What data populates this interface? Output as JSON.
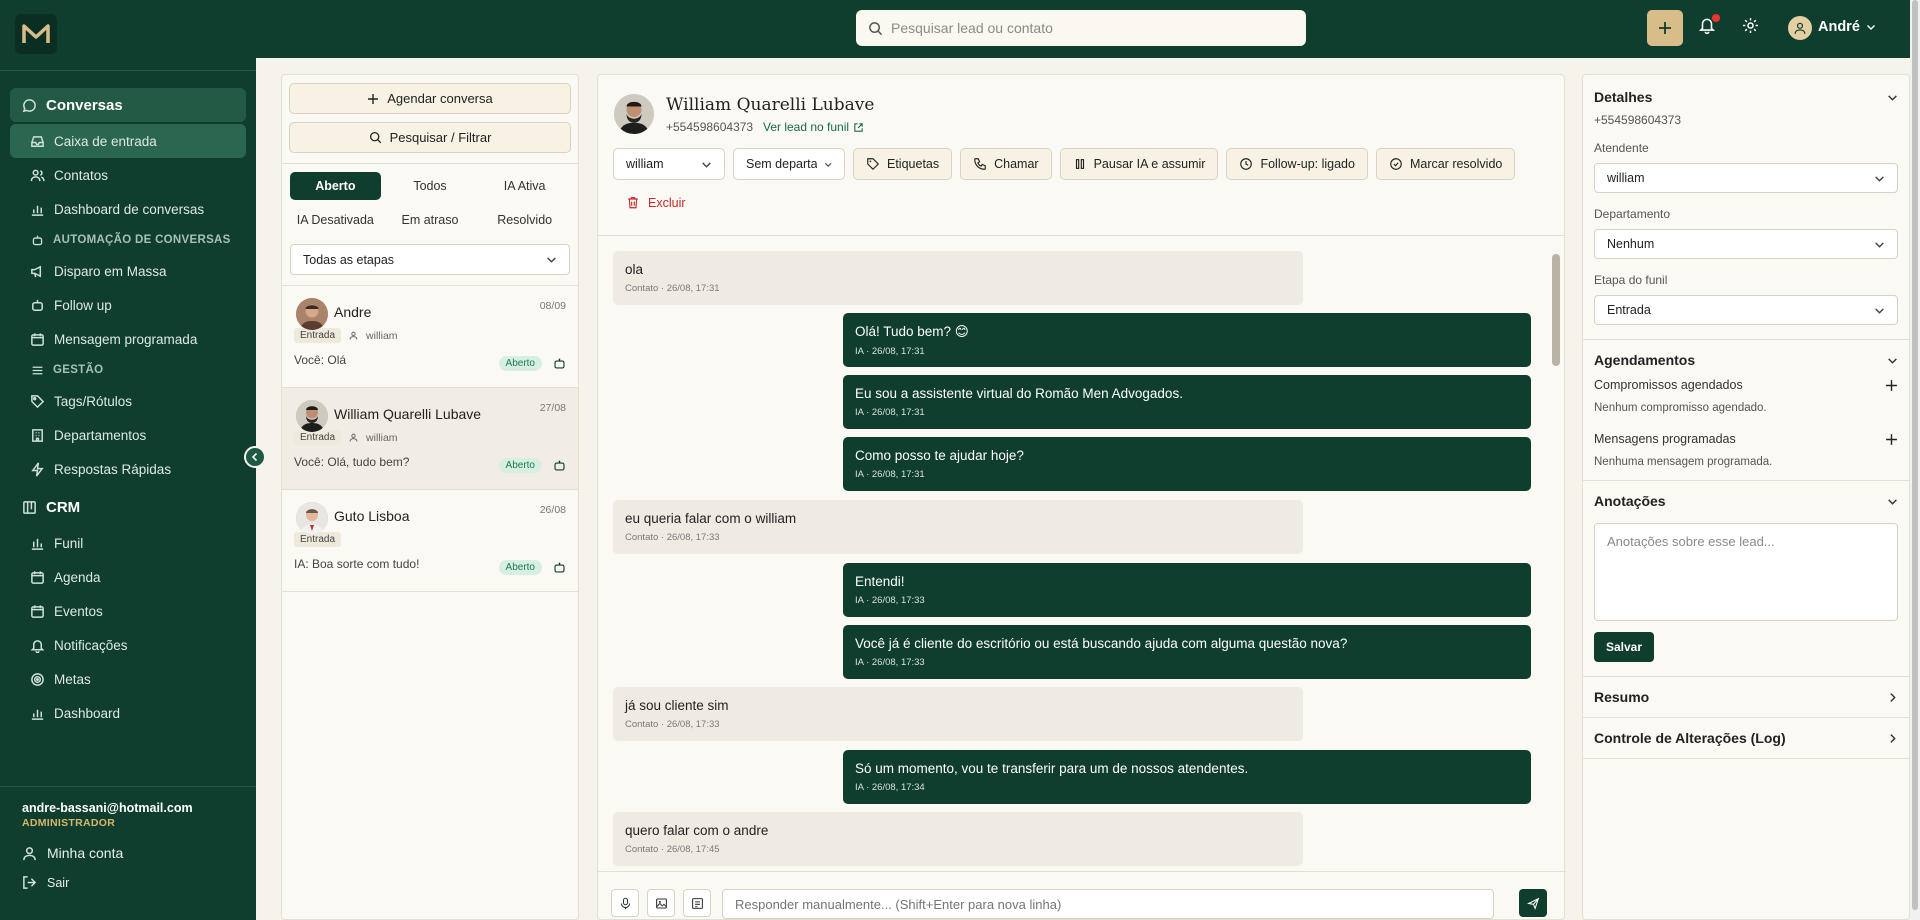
{
  "app": {
    "logo_letter": "M"
  },
  "topbar": {
    "search_placeholder": "Pesquisar lead ou contato",
    "user_name": "André"
  },
  "sidebar": {
    "items": [
      {
        "label": "Conversas"
      },
      {
        "label": "Caixa de entrada"
      },
      {
        "label": "Contatos"
      },
      {
        "label": "Dashboard de conversas"
      },
      {
        "label": "AUTOMAÇÃO DE CONVERSAS"
      },
      {
        "label": "Disparo em Massa"
      },
      {
        "label": "Follow up"
      },
      {
        "label": "Mensagem programada"
      },
      {
        "label": "GESTÃO"
      },
      {
        "label": "Tags/Rótulos"
      },
      {
        "label": "Departamentos"
      },
      {
        "label": "Respostas Rápidas"
      },
      {
        "label": "CRM"
      },
      {
        "label": "Funil"
      },
      {
        "label": "Agenda"
      },
      {
        "label": "Eventos"
      },
      {
        "label": "Notificações"
      },
      {
        "label": "Metas"
      },
      {
        "label": "Dashboard"
      }
    ],
    "user_email": "andre-bassani@hotmail.com",
    "user_role": "ADMINISTRADOR",
    "my_account": "Minha conta",
    "logout": "Sair"
  },
  "list": {
    "schedule_btn": "Agendar conversa",
    "search_btn": "Pesquisar / Filtrar",
    "tabs": [
      "Aberto",
      "Todos",
      "IA Ativa",
      "IA Desativada",
      "Em atraso",
      "Resolvido"
    ],
    "stage_filter": "Todas as etapas",
    "conversations": [
      {
        "name": "Andre",
        "date": "08/09",
        "stage": "Entrada",
        "agent": "william",
        "preview": "Você: Olá",
        "status": "Aberto"
      },
      {
        "name": "William Quarelli Lubave",
        "date": "27/08",
        "stage": "Entrada",
        "agent": "william",
        "preview": "Você: Olá, tudo bem?",
        "status": "Aberto"
      },
      {
        "name": "Guto Lisboa",
        "date": "26/08",
        "stage": "Entrada",
        "agent": "",
        "preview": "IA: Boa sorte com tudo!",
        "status": "Aberto"
      }
    ]
  },
  "chat": {
    "name": "William Quarelli Lubave",
    "phone": "+554598604373",
    "lead_link": "Ver lead no funil",
    "agent_select": "william",
    "dept_select": "Sem departamento",
    "actions": {
      "tags": "Etiquetas",
      "call": "Chamar",
      "pause": "Pausar IA e assumir",
      "followup": "Follow-up: ligado",
      "resolve": "Marcar resolvido",
      "delete": "Excluir"
    },
    "messages": [
      {
        "dir": "in",
        "text": "ola",
        "time": "Contato · 26/08, 17:31"
      },
      {
        "dir": "out",
        "text": "Olá! Tudo bem? 😊",
        "time": "IA · 26/08, 17:31"
      },
      {
        "dir": "out",
        "text": "Eu sou a assistente virtual do Romão Men Advogados.",
        "time": "IA · 26/08, 17:31"
      },
      {
        "dir": "out",
        "text": "Como posso te ajudar hoje?",
        "time": "IA · 26/08, 17:31"
      },
      {
        "dir": "in",
        "text": "eu queria falar com o william",
        "time": "Contato · 26/08, 17:33"
      },
      {
        "dir": "out",
        "text": "Entendi!",
        "time": "IA · 26/08, 17:33"
      },
      {
        "dir": "out",
        "text": "Você já é cliente do escritório ou está buscando ajuda com alguma questão nova?",
        "time": "IA · 26/08, 17:33"
      },
      {
        "dir": "in",
        "text": "já sou cliente sim",
        "time": "Contato · 26/08, 17:33"
      },
      {
        "dir": "out",
        "text": "Só um momento, vou te transferir para um de nossos atendentes.",
        "time": "IA · 26/08, 17:34"
      },
      {
        "dir": "in",
        "text": "quero falar com o andre",
        "time": "Contato · 26/08, 17:45"
      }
    ],
    "composer_placeholder": "Responder manualmente... (Shift+Enter para nova linha)"
  },
  "details": {
    "title": "Detalhes",
    "phone": "+554598604373",
    "agent_label": "Atendente",
    "agent_value": "william",
    "dept_label": "Departamento",
    "dept_value": "Nenhum",
    "stage_label": "Etapa do funil",
    "stage_value": "Entrada",
    "schedules_title": "Agendamentos",
    "appointments_label": "Compromissos agendados",
    "appointments_empty": "Nenhum compromisso agendado.",
    "scheduled_msgs_label": "Mensagens programadas",
    "scheduled_msgs_empty": "Nenhuma mensagem programada.",
    "notes_title": "Anotações",
    "notes_placeholder": "Anotações sobre esse lead...",
    "save": "Salvar",
    "summary_title": "Resumo",
    "log_title": "Controle de Alterações (Log)"
  },
  "colors": {
    "brand": "#0f3d2e",
    "accent": "#d9bd88",
    "status_open": "#1d7a4f"
  }
}
